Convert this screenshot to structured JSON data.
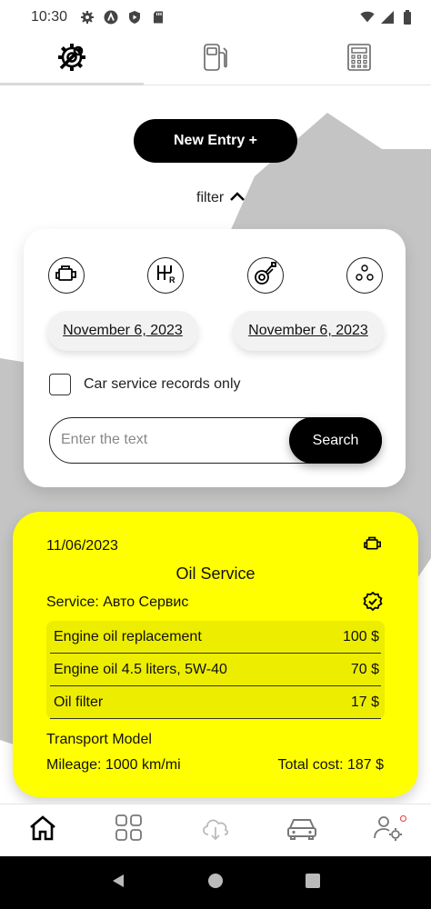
{
  "status_bar": {
    "time": "10:30",
    "left_icons": [
      "settings-icon",
      "a-circle-icon",
      "shield-play-icon",
      "sd-card-icon"
    ],
    "right_icons": [
      "wifi-icon",
      "signal-icon",
      "battery-icon"
    ]
  },
  "top_tabs": [
    {
      "icon": "engine-wrench-icon",
      "active": true
    },
    {
      "icon": "fuel-pump-icon",
      "active": false
    },
    {
      "icon": "calculator-icon",
      "active": false
    }
  ],
  "new_entry_label": "New Entry +",
  "filter": {
    "label": "filter",
    "categories": [
      "engine-icon",
      "gearbox-icon",
      "suspension-icon",
      "more-circles-icon"
    ],
    "date_from": "November 6, 2023",
    "date_to": "November 6, 2023",
    "checkbox_label": "Car service records only",
    "search_placeholder": "Enter the text",
    "search_button": "Search"
  },
  "record": {
    "date": "11/06/2023",
    "title": "Oil Service",
    "service": "Service: Авто Сервис",
    "items": [
      {
        "name": "Engine oil replacement",
        "cost": "100 $"
      },
      {
        "name": "Engine oil 4.5 liters, 5W-40",
        "cost": "70 $"
      },
      {
        "name": "Oil filter",
        "cost": "17 $"
      }
    ],
    "model": "Transport Model",
    "mileage": "Mileage: 1000 km/mi",
    "total": "Total cost: 187 $",
    "color": "#ffff00"
  },
  "bottom_nav": [
    "home-icon",
    "grid-icon",
    "cloud-download-icon",
    "car-icon",
    "user-settings-icon"
  ],
  "colors": {
    "accent": "#000000",
    "card": "#ffff00",
    "badge": "#e53935"
  }
}
